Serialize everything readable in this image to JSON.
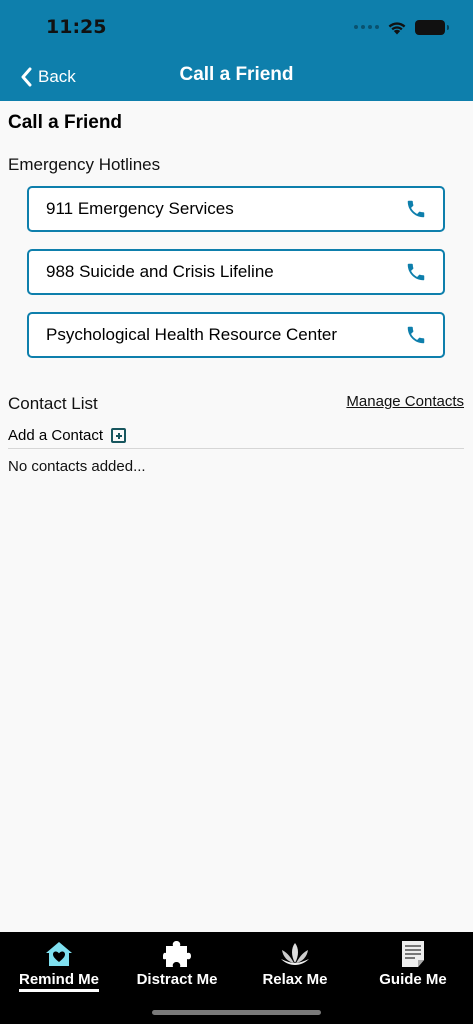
{
  "status_bar": {
    "time": "11:25"
  },
  "header": {
    "back_label": "Back",
    "title": "Call a Friend"
  },
  "page": {
    "title": "Call a Friend"
  },
  "emergency": {
    "heading": "Emergency Hotlines",
    "hotlines": [
      {
        "label": "911 Emergency Services",
        "icon": "phone-icon"
      },
      {
        "label": "988 Suicide and Crisis Lifeline",
        "icon": "phone-icon"
      },
      {
        "label": "Psychological Health Resource Center",
        "icon": "phone-icon"
      }
    ]
  },
  "contacts": {
    "heading": "Contact List",
    "manage_label": "Manage Contacts",
    "add_label": "Add a Contact",
    "empty_message": "No contacts added..."
  },
  "tabbar": {
    "tabs": [
      {
        "label": "Remind Me",
        "icon": "home-heart-icon",
        "active": true
      },
      {
        "label": "Distract Me",
        "icon": "puzzle-icon",
        "active": false
      },
      {
        "label": "Relax Me",
        "icon": "lotus-icon",
        "active": false
      },
      {
        "label": "Guide Me",
        "icon": "document-icon",
        "active": false
      }
    ]
  },
  "colors": {
    "header_bg": "#0e7fac",
    "accent": "#0e7fac",
    "tabbar_bg": "#000000",
    "active_icon": "#7fe0f0"
  }
}
